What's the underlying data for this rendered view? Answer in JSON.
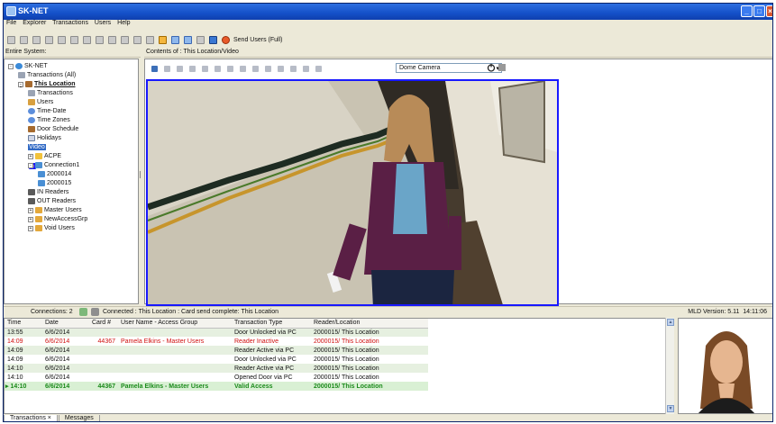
{
  "app": {
    "title": "SK-NET"
  },
  "menu": [
    "File",
    "Explorer",
    "Transactions",
    "Users",
    "Help"
  ],
  "toolbar": {
    "send_users_label": "Send Users (Full)"
  },
  "left_panel": {
    "header": "Entire System:"
  },
  "tree": [
    {
      "label": "SK-NET",
      "icon": "globe-icon",
      "level": 0,
      "expander": "-"
    },
    {
      "label": "Transactions (All)",
      "icon": "transactions-icon",
      "level": 1
    },
    {
      "label": "This Location",
      "icon": "location-icon",
      "level": 1,
      "expander": "-",
      "bold": true
    },
    {
      "label": "Transactions",
      "icon": "transactions-icon",
      "level": 2
    },
    {
      "label": "Users",
      "icon": "users-icon",
      "level": 2
    },
    {
      "label": "Time-Date",
      "icon": "clock-icon",
      "level": 2
    },
    {
      "label": "Time Zones",
      "icon": "clock-icon",
      "level": 2
    },
    {
      "label": "Door Schedule",
      "icon": "door-icon",
      "level": 2
    },
    {
      "label": "Holidays",
      "icon": "calendar-icon",
      "level": 2
    },
    {
      "label": "Video",
      "icon": "video-icon",
      "level": 2,
      "selected": true
    },
    {
      "label": "ACPE",
      "icon": "lock-icon",
      "level": 2,
      "expander": "+"
    },
    {
      "label": "Connection1",
      "icon": "connection-icon",
      "level": 2,
      "expander": "-"
    },
    {
      "label": "2000014",
      "icon": "connection-icon",
      "level": 3
    },
    {
      "label": "2000015",
      "icon": "connection-icon",
      "level": 3
    },
    {
      "label": "IN Readers",
      "icon": "reader-icon",
      "level": 2
    },
    {
      "label": "OUT Readers",
      "icon": "reader-icon",
      "level": 2
    },
    {
      "label": "Master Users",
      "icon": "group-icon",
      "level": 2,
      "expander": "+"
    },
    {
      "label": "NewAccessGrp",
      "icon": "group-icon",
      "level": 2,
      "expander": "+"
    },
    {
      "label": "Void Users",
      "icon": "group-icon",
      "level": 2,
      "expander": "+"
    }
  ],
  "content": {
    "header": "Contents of : This Location/Video",
    "camera_select": "Dome Camera"
  },
  "status": {
    "connections": "Connections: 2",
    "message": "Connected : This Location : Card send complete: This Location",
    "version": "MLD Version: 5.11",
    "time": "14:11:06"
  },
  "grid": {
    "columns": [
      "Time",
      "Date",
      "Card #",
      "User Name - Access Group",
      "Transaction Type",
      "Reader/Location"
    ],
    "rows": [
      {
        "time": "13:55",
        "date": "6/6/2014",
        "card": "",
        "user": "",
        "type": "Door Unlocked via PC",
        "reader": "2000015/ This Location",
        "style": ""
      },
      {
        "time": "14:09",
        "date": "6/6/2014",
        "card": "44367",
        "user": "Pamela Elkins - Master Users",
        "type": "Reader Inactive",
        "reader": "2000015/ This Location",
        "style": "red"
      },
      {
        "time": "14:09",
        "date": "6/6/2014",
        "card": "",
        "user": "",
        "type": "Reader Active via PC",
        "reader": "2000015/ This Location",
        "style": ""
      },
      {
        "time": "14:09",
        "date": "6/6/2014",
        "card": "",
        "user": "",
        "type": "Door Unlocked via PC",
        "reader": "2000015/ This Location",
        "style": ""
      },
      {
        "time": "14:10",
        "date": "6/6/2014",
        "card": "",
        "user": "",
        "type": "Reader Active via PC",
        "reader": "2000015/ This Location",
        "style": ""
      },
      {
        "time": "14:10",
        "date": "6/6/2014",
        "card": "",
        "user": "",
        "type": "Opened Door via PC",
        "reader": "2000015/ This Location",
        "style": ""
      },
      {
        "time": "14:10",
        "date": "6/6/2014",
        "card": "44367",
        "user": "Pamela Elkins - Master Users",
        "type": "Valid Access",
        "reader": "2000015/ This Location",
        "style": "last"
      }
    ]
  },
  "tabs": [
    "Transactions",
    "Messages"
  ]
}
